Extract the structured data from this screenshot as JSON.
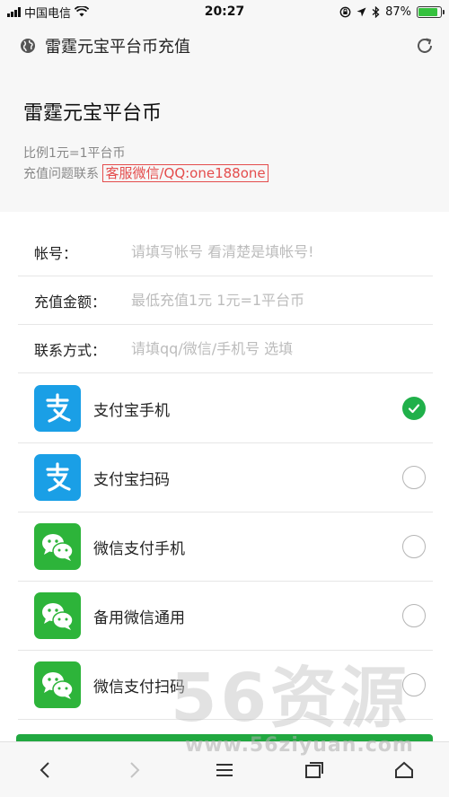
{
  "status_bar": {
    "carrier": "中国电信",
    "time": "20:27",
    "battery_text": "87%",
    "battery_level": 0.87
  },
  "nav": {
    "title": "雷霆元宝平台币充值",
    "left_icon": "globe-icon",
    "right_icon": "refresh-icon"
  },
  "header": {
    "title": "雷霆元宝平台币",
    "ratio": "比例1元=1平台币",
    "contact_label": "充值问题联系",
    "contact_value": "客服微信/QQ:one188one"
  },
  "form": {
    "account_label": "帐号：",
    "account_placeholder": "请填写帐号 看清楚是填帐号!",
    "amount_label": "充值金额：",
    "amount_placeholder": "最低充值1元 1元=1平台币",
    "contact_label": "联系方式：",
    "contact_placeholder": "请填qq/微信/手机号 选填"
  },
  "payments": [
    {
      "label": "支付宝手机",
      "icon": "alipay-icon",
      "selected": true
    },
    {
      "label": "支付宝扫码",
      "icon": "alipay-icon",
      "selected": false
    },
    {
      "label": "微信支付手机",
      "icon": "wechat-icon",
      "selected": false
    },
    {
      "label": "备用微信通用",
      "icon": "wechat-icon",
      "selected": false
    },
    {
      "label": "微信支付扫码",
      "icon": "wechat-icon",
      "selected": false
    }
  ],
  "watermark": {
    "big": "56资源",
    "url": "www.56ziyuan.com"
  },
  "colors": {
    "accent_green": "#20b04a",
    "alipay_blue": "#1a9fe6",
    "wechat_green": "#2db43a",
    "contact_red": "#e44c4c"
  }
}
